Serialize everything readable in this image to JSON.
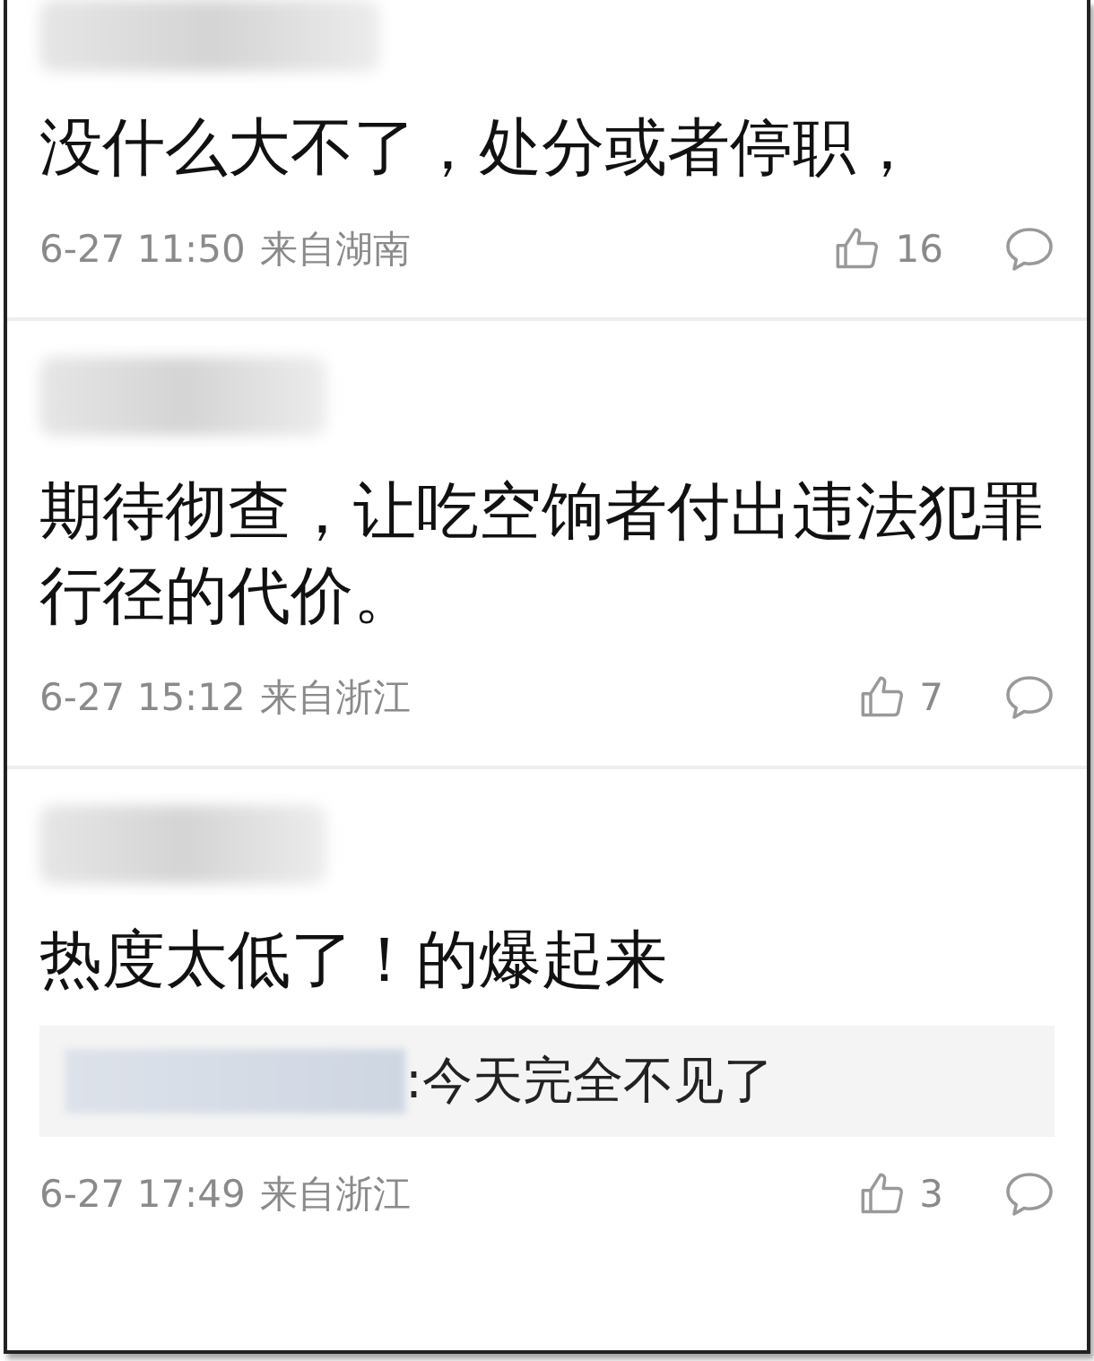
{
  "comments": [
    {
      "text": "没什么大不了，处分或者停职，",
      "time": "6-27 11:50",
      "location": "来自湖南",
      "likes": "16"
    },
    {
      "text": "期待彻查，让吃空饷者付出违法犯罪行径的代价。",
      "time": "6-27 15:12",
      "location": "来自浙江",
      "likes": "7"
    },
    {
      "text": "热度太低了！的爆起来",
      "reply": {
        "text": ":今天完全不见了"
      },
      "time": "6-27 17:49",
      "location": "来自浙江",
      "likes": "3"
    }
  ]
}
